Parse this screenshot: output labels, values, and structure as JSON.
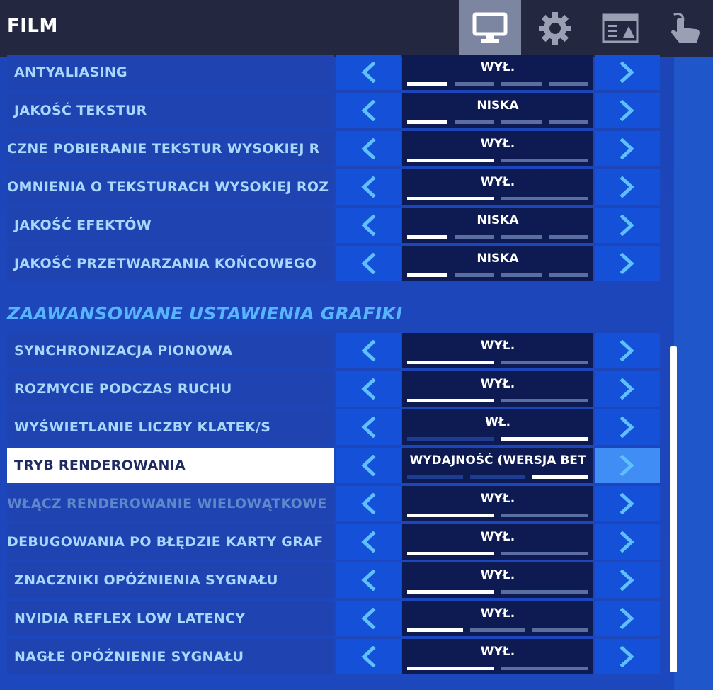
{
  "header": {
    "title": "FILM",
    "tabs": [
      {
        "name": "video-tab",
        "icon": "monitor-icon",
        "active": true
      },
      {
        "name": "game-settings-tab",
        "icon": "gear-icon",
        "active": false
      },
      {
        "name": "hud-tab",
        "icon": "layout-icon",
        "active": false
      },
      {
        "name": "touch-tab",
        "icon": "touch-hand-icon",
        "active": false
      }
    ]
  },
  "section_title": "ZAAWANSOWANE USTAWIENIA GRAFIKI",
  "settings_top": [
    {
      "label": "ANTYALIASING",
      "value": "WYŁ.",
      "steps": 4,
      "selected_index": 0
    },
    {
      "label": "JAKOŚĆ TEKSTUR",
      "value": "NISKA",
      "steps": 4,
      "selected_index": 0
    },
    {
      "label": "CZNE POBIERANIE TEKSTUR WYSOKIEJ R",
      "value": "WYŁ.",
      "steps": 2,
      "selected_index": 0
    },
    {
      "label": "OMNIENIA O TEKSTURACH WYSOKIEJ ROZ",
      "value": "WYŁ.",
      "steps": 2,
      "selected_index": 0
    },
    {
      "label": "JAKOŚĆ EFEKTÓW",
      "value": "NISKA",
      "steps": 4,
      "selected_index": 0
    },
    {
      "label": "JAKOŚĆ PRZETWARZANIA KOŃCOWEGO",
      "value": "NISKA",
      "steps": 4,
      "selected_index": 0
    }
  ],
  "settings_advanced": [
    {
      "label": "SYNCHRONIZACJA PIONOWA",
      "value": "WYŁ.",
      "steps": 2,
      "selected_index": 0
    },
    {
      "label": "ROZMYCIE PODCZAS RUCHU",
      "value": "WYŁ.",
      "steps": 2,
      "selected_index": 0
    },
    {
      "label": "WYŚWIETLANIE LICZBY KLATEK/S",
      "value": "WŁ.",
      "steps": 2,
      "selected_index": 1
    },
    {
      "label": "TRYB RENDEROWANIA",
      "value": "WYDAJNOŚĆ (WERSJA BET",
      "steps": 3,
      "selected_index": 2
    },
    {
      "label": "WŁĄCZ RENDEROWANIE WIELOWĄTKOWE",
      "value": "WYŁ.",
      "steps": 2,
      "selected_index": 0
    },
    {
      "label": "DEBUGOWANIA PO BŁĘDZIE KARTY GRAF",
      "value": "WYŁ.",
      "steps": 2,
      "selected_index": 0
    },
    {
      "label": "ZNACZNIKI OPÓŹNIENIA SYGNAŁU",
      "value": "WYŁ.",
      "steps": 2,
      "selected_index": 0
    },
    {
      "label": "NVIDIA REFLEX LOW LATENCY",
      "value": "WYŁ.",
      "steps": 3,
      "selected_index": 0
    },
    {
      "label": "NAGŁE OPÓŹNIENIE SYGNAŁU",
      "value": "WYŁ.",
      "steps": 2,
      "selected_index": 0
    }
  ],
  "colors": {
    "header_bg": "#232840",
    "accent_light_blue": "#a9d8ff",
    "section_title": "#59b4ff",
    "value_box": "#0e1a52",
    "arrow_bg": "#1450d8"
  }
}
